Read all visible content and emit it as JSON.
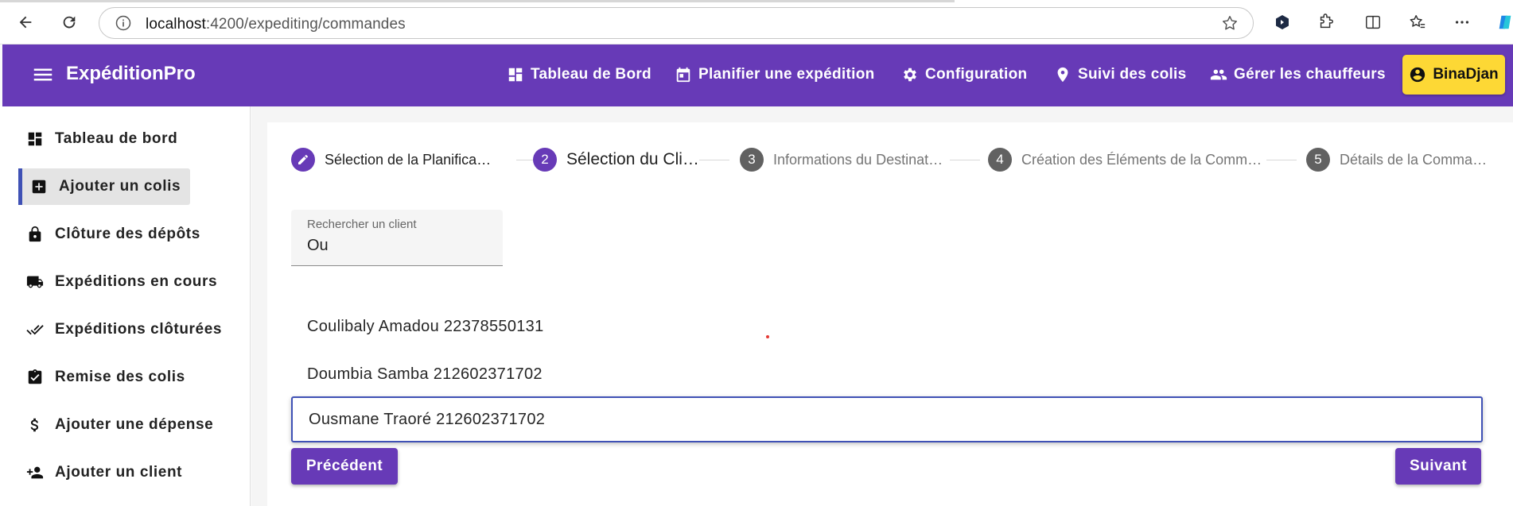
{
  "browser": {
    "url_host": "localhost",
    "url_path": ":4200/expediting/commandes"
  },
  "header": {
    "app_title": "ExpéditionPro",
    "nav": [
      {
        "label": "Tableau de Bord",
        "icon": "dashboard-icon"
      },
      {
        "label": "Planifier une expédition",
        "icon": "calendar-icon"
      },
      {
        "label": "Configuration",
        "icon": "gear-icon"
      },
      {
        "label": "Suivi des colis",
        "icon": "location-pin-icon"
      },
      {
        "label": "Gérer les chauffeurs",
        "icon": "people-icon"
      }
    ],
    "user": "BinaDjan"
  },
  "sidebar": {
    "items": [
      {
        "label": "Tableau de bord",
        "icon": "dashboard-icon"
      },
      {
        "label": "Ajouter un colis",
        "icon": "add-box-icon",
        "active": true
      },
      {
        "label": "Clôture des dépôts",
        "icon": "lock-icon"
      },
      {
        "label": "Expéditions en cours",
        "icon": "truck-icon"
      },
      {
        "label": "Expéditions clôturées",
        "icon": "double-check-icon"
      },
      {
        "label": "Remise des colis",
        "icon": "clipboard-check-icon"
      },
      {
        "label": "Ajouter une dépense",
        "icon": "dollar-icon"
      },
      {
        "label": "Ajouter un client",
        "icon": "person-add-icon"
      }
    ]
  },
  "stepper": {
    "steps": [
      {
        "number": "1",
        "label": "Sélection de la Planifica…",
        "state": "done"
      },
      {
        "number": "2",
        "label": "Sélection du Cli…",
        "state": "current"
      },
      {
        "number": "3",
        "label": "Informations du Destinat…",
        "state": "pending"
      },
      {
        "number": "4",
        "label": "Création des Éléments de la Comm…",
        "state": "pending"
      },
      {
        "number": "5",
        "label": "Détails de la Comma…",
        "state": "pending"
      }
    ]
  },
  "search": {
    "label": "Rechercher un client",
    "value": "Ou"
  },
  "options": [
    {
      "text": "Coulibaly Amadou 22378550131"
    },
    {
      "text": "Doumbia Samba 212602371702"
    },
    {
      "text": "Ousmane Traoré 212602371702",
      "selected": true
    }
  ],
  "buttons": {
    "previous": "Précédent",
    "next": "Suivant"
  },
  "colors": {
    "primary": "#673ab7",
    "accent": "#fdd835",
    "focus": "#3f51b5"
  }
}
